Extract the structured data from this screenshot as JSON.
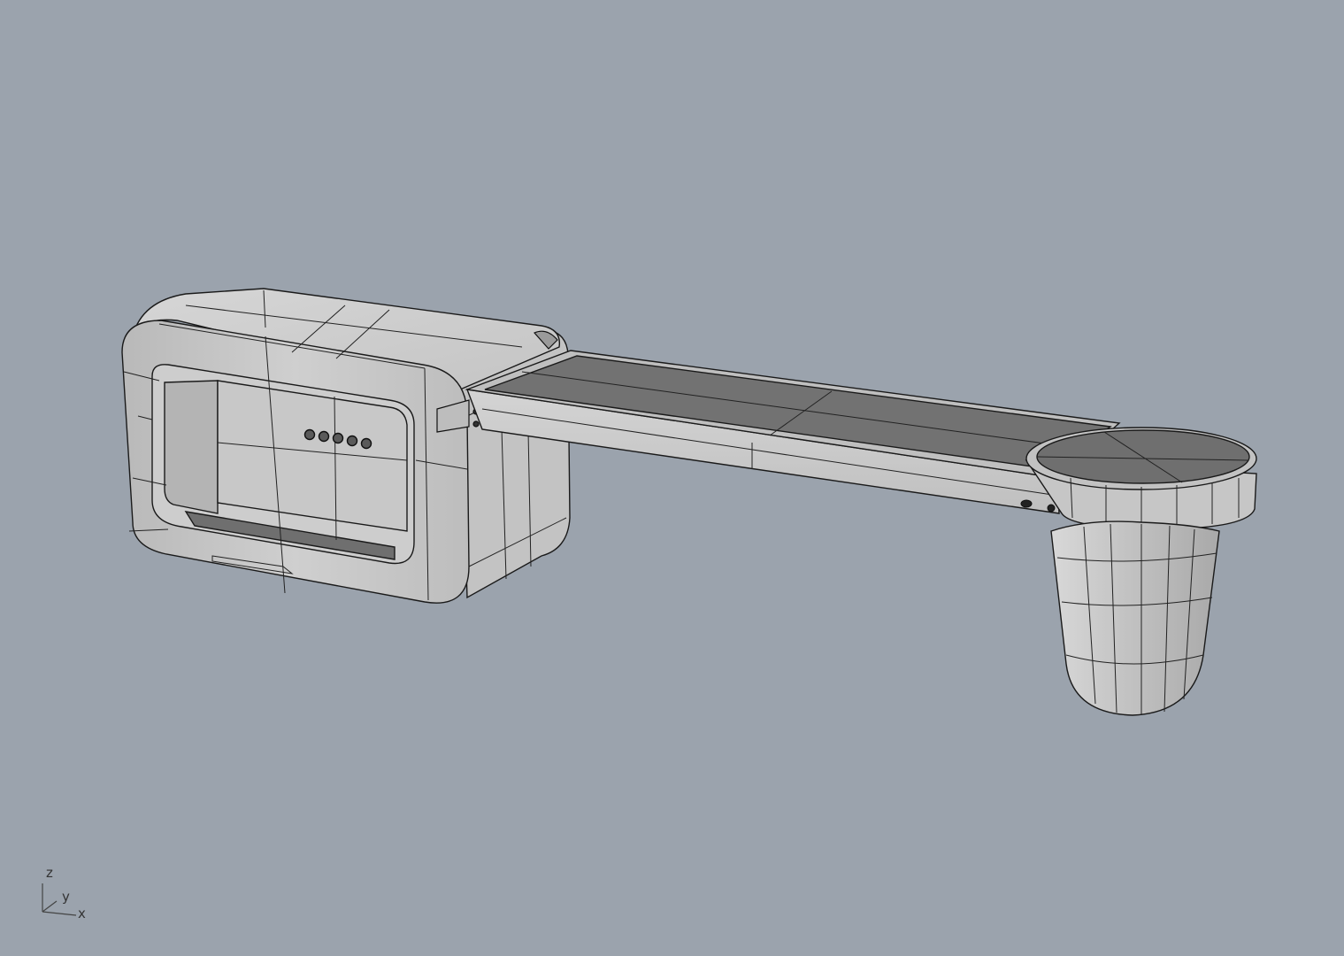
{
  "viewport": {
    "background": "#9ba3ad",
    "display_mode": "shaded"
  },
  "axis_widget": {
    "z_label": "z",
    "y_label": "y",
    "x_label": "x"
  },
  "model": {
    "surface_color": "#c9c9c9",
    "dark_surface_color": "#6e6e6e",
    "edge_color": "#1a1a1a",
    "button_count": 5
  }
}
